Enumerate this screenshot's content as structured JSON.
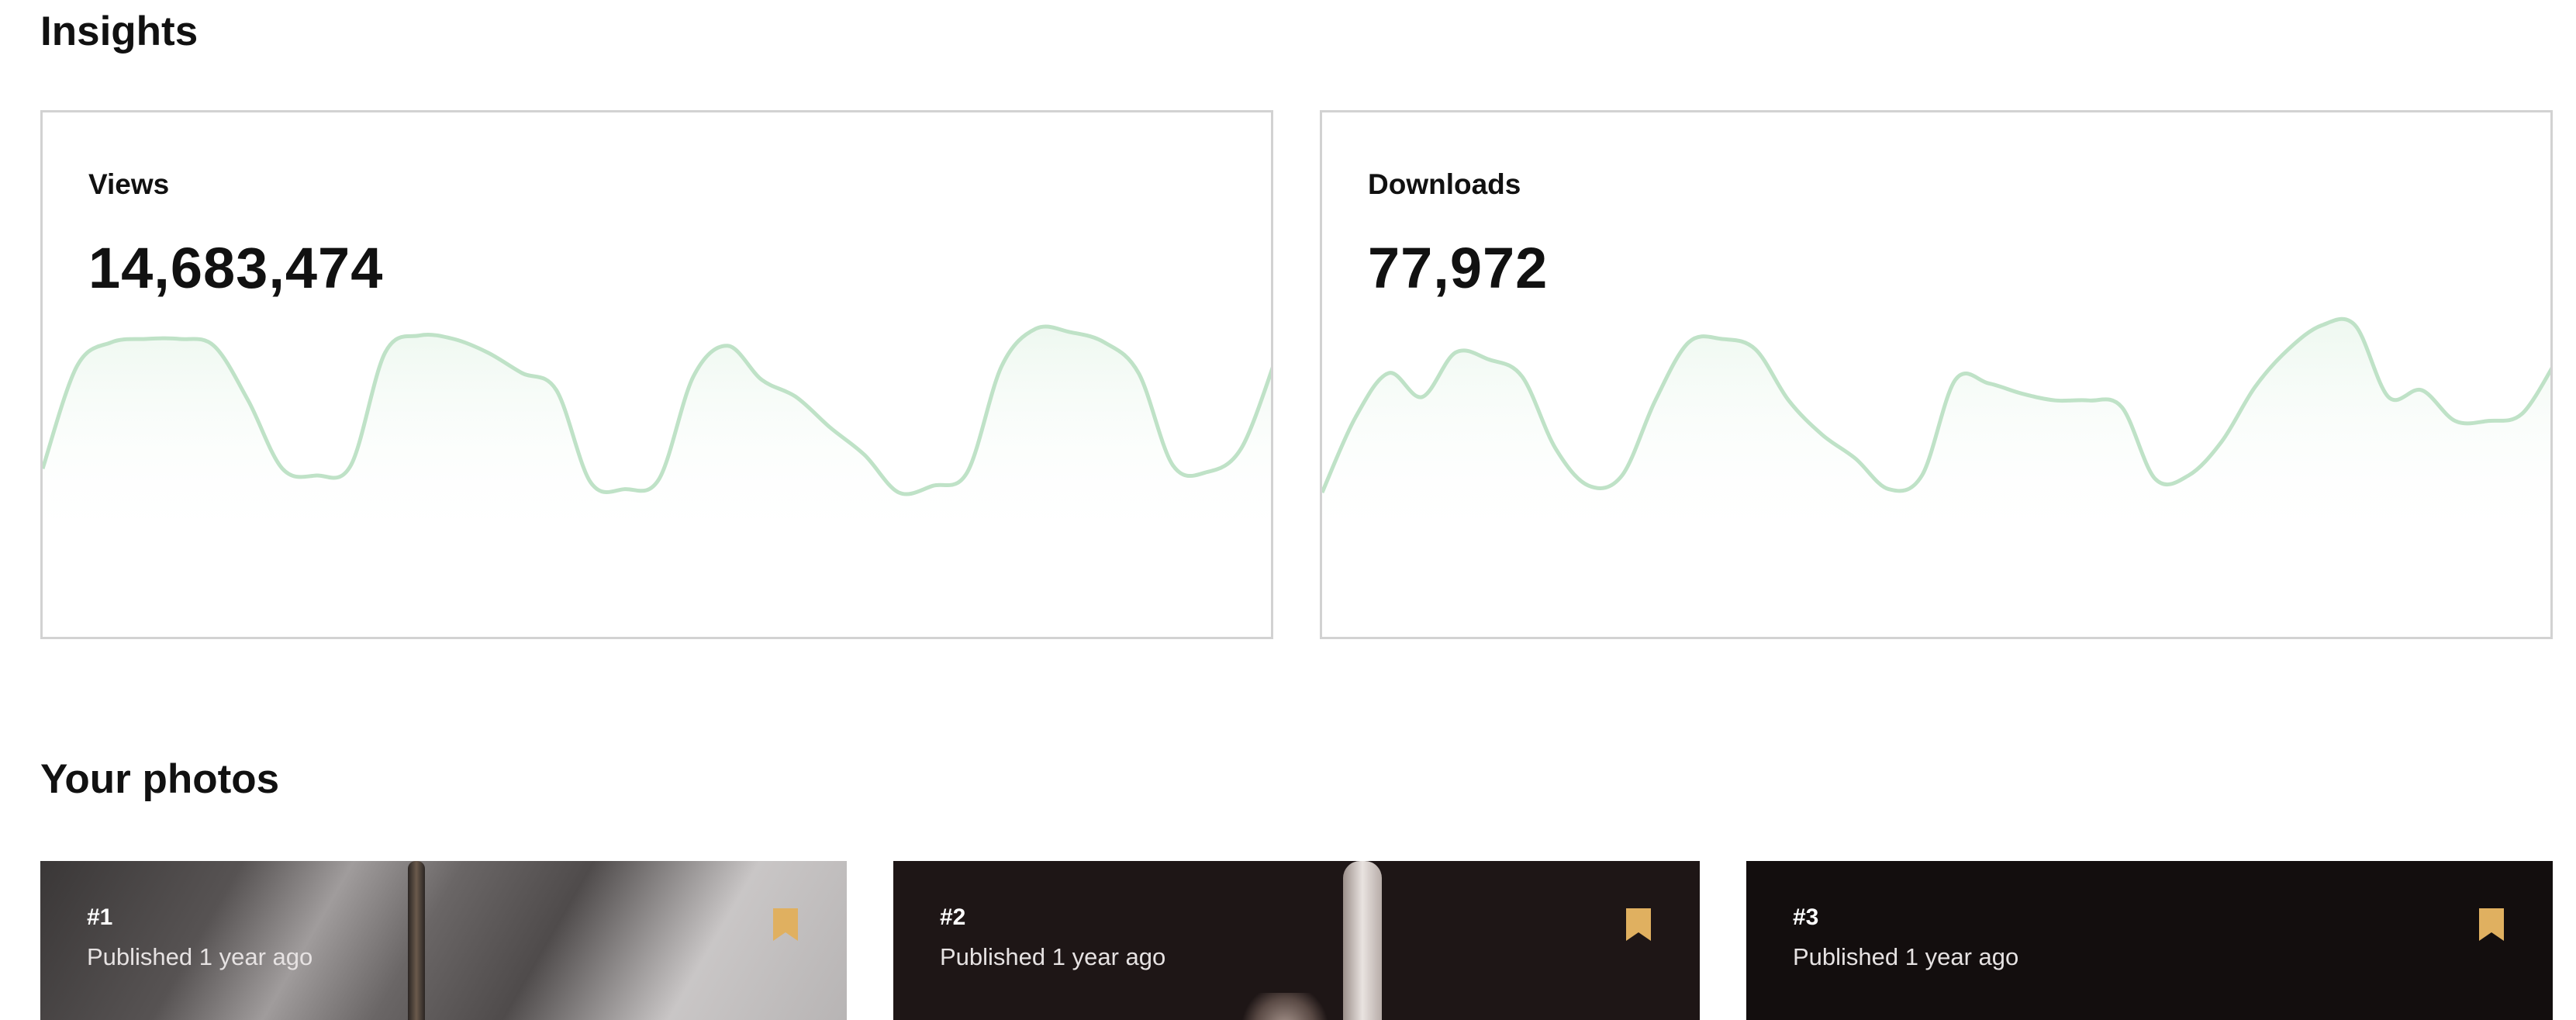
{
  "insights": {
    "title": "Insights",
    "cards": [
      {
        "label": "Views",
        "value": "14,683,474",
        "trend": [
          0.32,
          0.62,
          0.69,
          0.7,
          0.7,
          0.68,
          0.52,
          0.32,
          0.3,
          0.33,
          0.66,
          0.71,
          0.7,
          0.66,
          0.6,
          0.55,
          0.28,
          0.26,
          0.29,
          0.59,
          0.68,
          0.58,
          0.53,
          0.44,
          0.36,
          0.25,
          0.27,
          0.31,
          0.62,
          0.73,
          0.72,
          0.69,
          0.6,
          0.33,
          0.31,
          0.38,
          0.64
        ]
      },
      {
        "label": "Downloads",
        "value": "77,972",
        "trend": [
          0.25,
          0.47,
          0.6,
          0.53,
          0.66,
          0.64,
          0.59,
          0.38,
          0.27,
          0.3,
          0.52,
          0.69,
          0.7,
          0.67,
          0.52,
          0.42,
          0.35,
          0.26,
          0.3,
          0.58,
          0.57,
          0.54,
          0.52,
          0.52,
          0.5,
          0.29,
          0.3,
          0.4,
          0.56,
          0.67,
          0.74,
          0.74,
          0.53,
          0.55,
          0.46,
          0.46,
          0.48,
          0.63
        ]
      }
    ],
    "line_color": "#bfe2c7",
    "fill_color": "#eef8f0"
  },
  "photos": {
    "title": "Your photos",
    "items": [
      {
        "rank": "#1",
        "published": "Published 1 year ago"
      },
      {
        "rank": "#2",
        "published": "Published 1 year ago"
      },
      {
        "rank": "#3",
        "published": "Published 1 year ago"
      }
    ],
    "bookmark_icon": "bookmark-icon",
    "bookmark_color": "#e0b060"
  }
}
